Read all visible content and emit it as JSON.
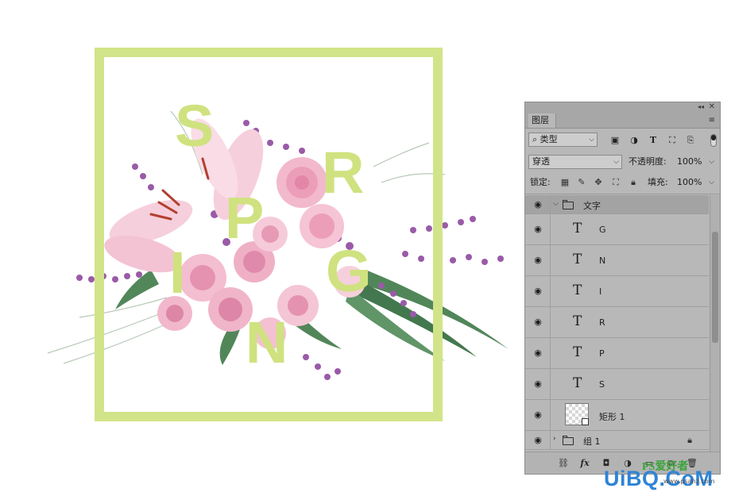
{
  "artwork": {
    "spring_letters": [
      "S",
      "P",
      "R",
      "I",
      "N",
      "G"
    ],
    "colors": {
      "frame": "#d2e489",
      "letters": "#cfe27f",
      "petals": "#f2b9cd",
      "lavender": "#9a5aa8",
      "leaves": "#3f7a48"
    }
  },
  "layers_panel": {
    "tab_title": "图层",
    "filter": {
      "kind_value": "类型"
    },
    "blend_mode": "穿透",
    "opacity_label": "不透明度:",
    "opacity_value": "100%",
    "lock_label": "锁定:",
    "fill_label": "填充:",
    "fill_value": "100%",
    "group_open": {
      "name": "文字"
    },
    "text_layers": [
      "G",
      "N",
      "I",
      "R",
      "P",
      "S"
    ],
    "rect_layer": {
      "name": "矩形 1"
    },
    "group_closed": {
      "name": "组 1"
    },
    "bottom_buttons": [
      "link-icon",
      "fx-icon",
      "mask-icon",
      "adjustment-icon",
      "new-group-icon",
      "new-layer-icon",
      "trash-icon"
    ],
    "colors": {
      "panel_bg": "#b8b8b8",
      "group_row": "#a3a3a3"
    }
  },
  "watermark": {
    "main": "UiBQ.CoM",
    "sub": "PS爱好者",
    "url": "www.psahz.com"
  }
}
